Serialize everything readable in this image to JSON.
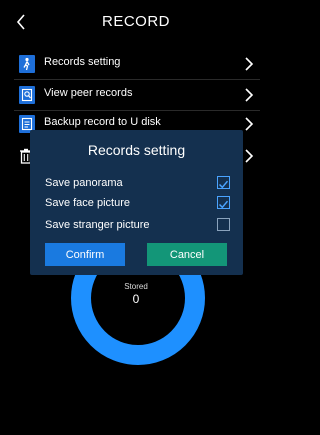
{
  "header": {
    "title": "RECORD",
    "back_icon": "chevron-left-icon"
  },
  "menu": {
    "items": [
      {
        "label": "Records setting",
        "icon": "person-walk-icon"
      },
      {
        "label": "View peer records",
        "icon": "search-doc-icon"
      },
      {
        "label": "Backup record to U disk",
        "icon": "usb-doc-icon"
      },
      {
        "label": "",
        "icon": "trash-icon"
      }
    ]
  },
  "gauge": {
    "label": "Stored",
    "value": "0",
    "color": "#1e90ff"
  },
  "dialog": {
    "title": "Records setting",
    "options": [
      {
        "label": "Save panorama",
        "checked": true
      },
      {
        "label": "Save face picture",
        "checked": true
      },
      {
        "label": "Save stranger picture",
        "checked": false
      }
    ],
    "confirm_label": "Confirm",
    "cancel_label": "Cancel"
  },
  "colors": {
    "accent": "#1a7ae0",
    "cancel": "#139678",
    "dialog_bg": "#14304f"
  }
}
